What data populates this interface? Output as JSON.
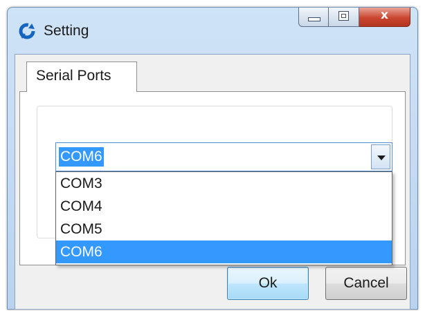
{
  "window": {
    "title": "Setting",
    "app_icon": "refresh-icon",
    "controls": {
      "minimize": "minimize-icon",
      "maximize": "maximize-icon",
      "close": "x"
    }
  },
  "tabs": [
    {
      "label": "Serial Ports",
      "active": true
    }
  ],
  "serial_port": {
    "selected": "COM6",
    "options": [
      "COM3",
      "COM4",
      "COM5",
      "COM6"
    ],
    "highlighted_index": 3
  },
  "buttons": {
    "ok": "Ok",
    "cancel": "Cancel"
  },
  "colors": {
    "selection": "#3399ff",
    "title_gradient_top": "#cfe3f6",
    "close_button": "#c9462f"
  }
}
